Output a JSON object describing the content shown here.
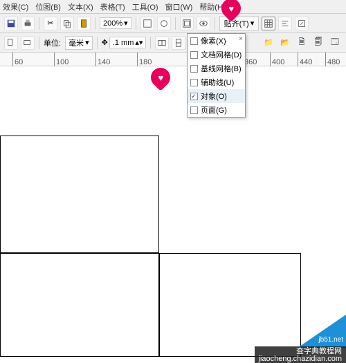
{
  "menus": {
    "effect": "效果(C)",
    "bitmap": "位图(B)",
    "text": "文本(X)",
    "table": "表格(T)",
    "tool": "工具(O)",
    "window": "窗口(W)",
    "help": "帮助(H)"
  },
  "toolbar": {
    "zoom": "200%",
    "snap_label": "贴齐(T)",
    "snap_arrow": "▾"
  },
  "property": {
    "unit_label": "单位:",
    "unit_value": "毫米",
    "nudge": ".1 mm"
  },
  "ruler": {
    "t60": "60",
    "t100": "100",
    "t140": "140",
    "t180": "180",
    "t360": "360",
    "t400": "400",
    "t440": "440",
    "t480": "480"
  },
  "dropdown": {
    "pixel": "像素(X)",
    "docgrid": "文档网格(D)",
    "baseline": "基线网格(B)",
    "guide": "辅助线(U)",
    "object": "对象(O)",
    "page": "页面(G)",
    "close": "×"
  },
  "watermark": {
    "line1": "查字典教程网",
    "line2": "jiaocheng.chazidian.com",
    "corner": "jb51.net"
  }
}
